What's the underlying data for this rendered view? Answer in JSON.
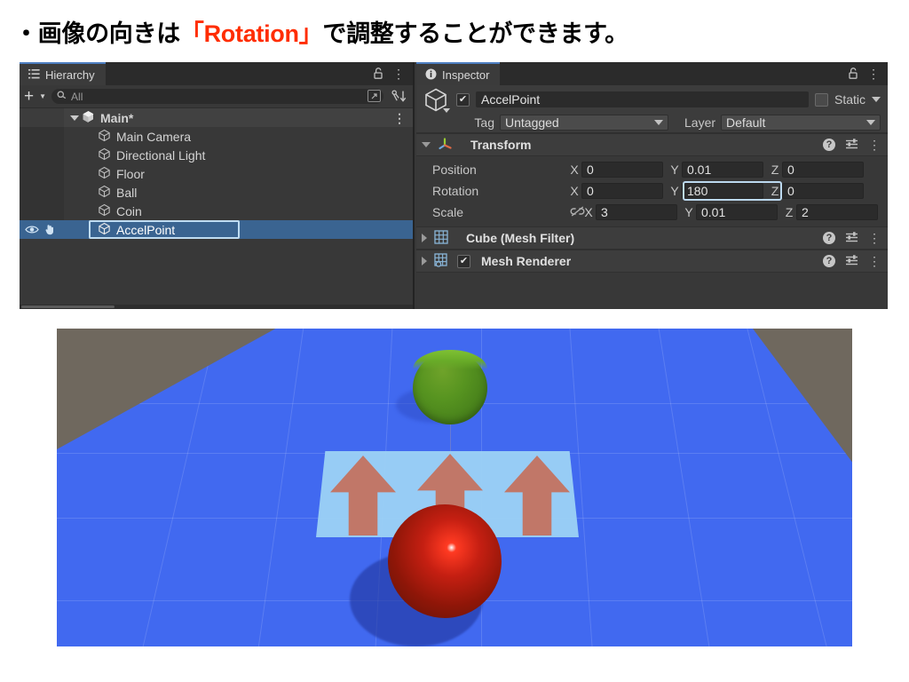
{
  "headline": {
    "bullet": "・",
    "part1": "画像の向きは",
    "accent": "「Rotation」",
    "part2": "で調整することができます。",
    "accent_color": "#ff2d00"
  },
  "hierarchy": {
    "tab_label": "Hierarchy",
    "tab_icon": "hierarchy-list-icon",
    "lock_icon": "lock-open-icon",
    "menu_icon": "kebab-menu-icon",
    "create_button": "+",
    "create_caret": "▼",
    "search": {
      "placeholder": "All",
      "value": "",
      "icon": "search-icon"
    },
    "search_expand_icon": "open-in-new-icon",
    "sort_icon": "sort-alphabetical-icon",
    "scene_root": {
      "label": "Main*",
      "icon": "unity-scene-icon",
      "expanded": true
    },
    "items": [
      {
        "label": "Main Camera",
        "icon": "gameobject-cube-icon",
        "selected": false
      },
      {
        "label": "Directional Light",
        "icon": "gameobject-cube-icon",
        "selected": false
      },
      {
        "label": "Floor",
        "icon": "gameobject-cube-icon",
        "selected": false
      },
      {
        "label": "Ball",
        "icon": "gameobject-cube-icon",
        "selected": false
      },
      {
        "label": "Coin",
        "icon": "gameobject-cube-icon",
        "selected": false
      },
      {
        "label": "AccelPoint",
        "icon": "gameobject-cube-icon",
        "selected": true
      }
    ],
    "selected_row_icons": [
      "eye-icon",
      "hand-pointer-icon"
    ]
  },
  "inspector": {
    "tab_label": "Inspector",
    "tab_icon": "info-circle-icon",
    "lock_icon": "lock-open-icon",
    "menu_icon": "kebab-menu-icon",
    "object": {
      "icon": "gameobject-cube-icon",
      "enabled": true,
      "name": "AccelPoint",
      "static_label": "Static",
      "static_checked": false
    },
    "tag_label": "Tag",
    "tag_value": "Untagged",
    "layer_label": "Layer",
    "layer_value": "Default",
    "components": [
      {
        "title": "Transform",
        "icon": "transform-axis-icon",
        "expanded": true,
        "help_icon": "help-circle-icon",
        "preset_icon": "preset-sliders-icon",
        "menu_icon": "kebab-menu-icon"
      },
      {
        "title": "Cube (Mesh Filter)",
        "icon": "mesh-filter-grid-icon",
        "expanded": false,
        "help_icon": "help-circle-icon",
        "preset_icon": "preset-sliders-icon",
        "menu_icon": "kebab-menu-icon"
      },
      {
        "title": "Mesh Renderer",
        "icon": "mesh-renderer-icon",
        "expanded": false,
        "enabled": true,
        "help_icon": "help-circle-icon",
        "preset_icon": "preset-sliders-icon",
        "menu_icon": "kebab-menu-icon"
      }
    ],
    "transform": {
      "rows": [
        {
          "name": "Position",
          "x": "0",
          "y": "0.01",
          "z": "0",
          "link_icon": null
        },
        {
          "name": "Rotation",
          "x": "0",
          "y": "180",
          "z": "0",
          "link_icon": null,
          "highlight": "y"
        },
        {
          "name": "Scale",
          "x": "3",
          "y": "0.01",
          "z": "2",
          "link_icon": "link-broken-icon"
        }
      ],
      "axis_labels": {
        "x": "X",
        "y": "Y",
        "z": "Z"
      },
      "highlight_color": "#bcd9f0"
    }
  },
  "scene": {
    "name": "scene-view-render",
    "background_color": "#6f685e",
    "floor_color": "#4169f0",
    "plane_color": "#9bd0f5",
    "arrow_color": "#c4705c",
    "coin_color": "#579420",
    "ball_color": "#c51f12",
    "objects": [
      {
        "name": "Floor",
        "shape": "plane",
        "color": "#4169f0"
      },
      {
        "name": "Coin",
        "shape": "cylinder",
        "color": "#579420"
      },
      {
        "name": "AccelPoint",
        "shape": "quad",
        "color": "#9bd0f5",
        "arrows": 3,
        "arrow_color": "#c4705c"
      },
      {
        "name": "Ball",
        "shape": "sphere",
        "color": "#c51f12"
      }
    ]
  }
}
